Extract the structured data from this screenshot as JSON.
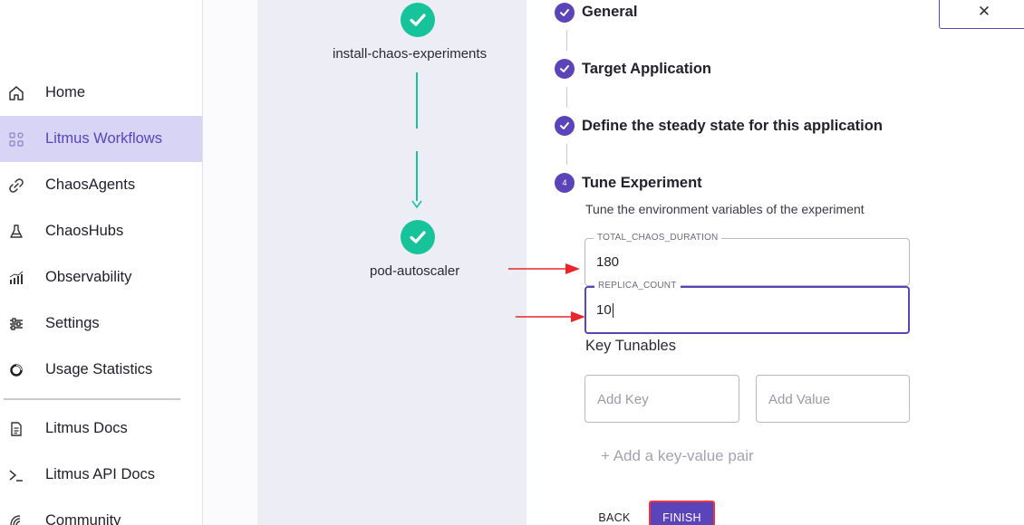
{
  "sidebar": {
    "items": [
      {
        "label": "Home",
        "icon": "home-icon"
      },
      {
        "label": "Litmus Workflows",
        "icon": "workflows-grid-icon"
      },
      {
        "label": "ChaosAgents",
        "icon": "link-icon"
      },
      {
        "label": "ChaosHubs",
        "icon": "flask-icon"
      },
      {
        "label": "Observability",
        "icon": "bar-chart-icon"
      },
      {
        "label": "Settings",
        "icon": "sliders-icon"
      },
      {
        "label": "Usage Statistics",
        "icon": "donut-icon"
      },
      {
        "label": "Litmus Docs",
        "icon": "document-icon"
      },
      {
        "label": "Litmus API Docs",
        "icon": "terminal-icon"
      },
      {
        "label": "Community",
        "icon": "community-icon"
      }
    ],
    "active_index": 1
  },
  "graph": {
    "nodes": [
      {
        "label": "install-chaos-experiments",
        "status": "completed"
      },
      {
        "label": "pod-autoscaler",
        "status": "completed"
      }
    ]
  },
  "form": {
    "close_label": "✕",
    "steps": [
      {
        "title": "General",
        "state": "done"
      },
      {
        "title": "Target Application",
        "state": "done"
      },
      {
        "title": "Define the steady state for this application",
        "state": "done"
      },
      {
        "title": "Tune Experiment",
        "state": "active",
        "number": "4"
      }
    ],
    "tune": {
      "description": "Tune the environment variables of the experiment",
      "fields": [
        {
          "label": "TOTAL_CHAOS_DURATION",
          "value": "180"
        },
        {
          "label": "REPLICA_COUNT",
          "value": "10"
        }
      ],
      "key_tunables_heading": "Key Tunables",
      "key_placeholder": "Add Key",
      "value_placeholder": "Add Value",
      "add_pair_label": "+ Add a key-value pair"
    },
    "buttons": {
      "back": "BACK",
      "finish": "FINISH"
    }
  },
  "colors": {
    "accent": "#5b44ba",
    "success": "#17c39a",
    "annotation_arrow": "#e8262b"
  }
}
